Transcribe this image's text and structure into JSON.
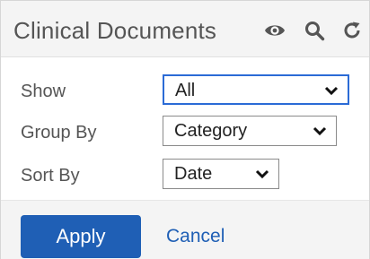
{
  "header": {
    "title": "Clinical Documents",
    "icons": [
      "eye-icon",
      "search-icon",
      "refresh-icon"
    ]
  },
  "filters": {
    "show": {
      "label": "Show",
      "value": "All"
    },
    "group_by": {
      "label": "Group By",
      "value": "Category"
    },
    "sort_by": {
      "label": "Sort By",
      "value": "Date"
    }
  },
  "footer": {
    "apply_label": "Apply",
    "cancel_label": "Cancel"
  },
  "colors": {
    "accent": "#1f5fb5",
    "focus": "#2b6bd6",
    "header_bg": "#f4f4f4"
  }
}
